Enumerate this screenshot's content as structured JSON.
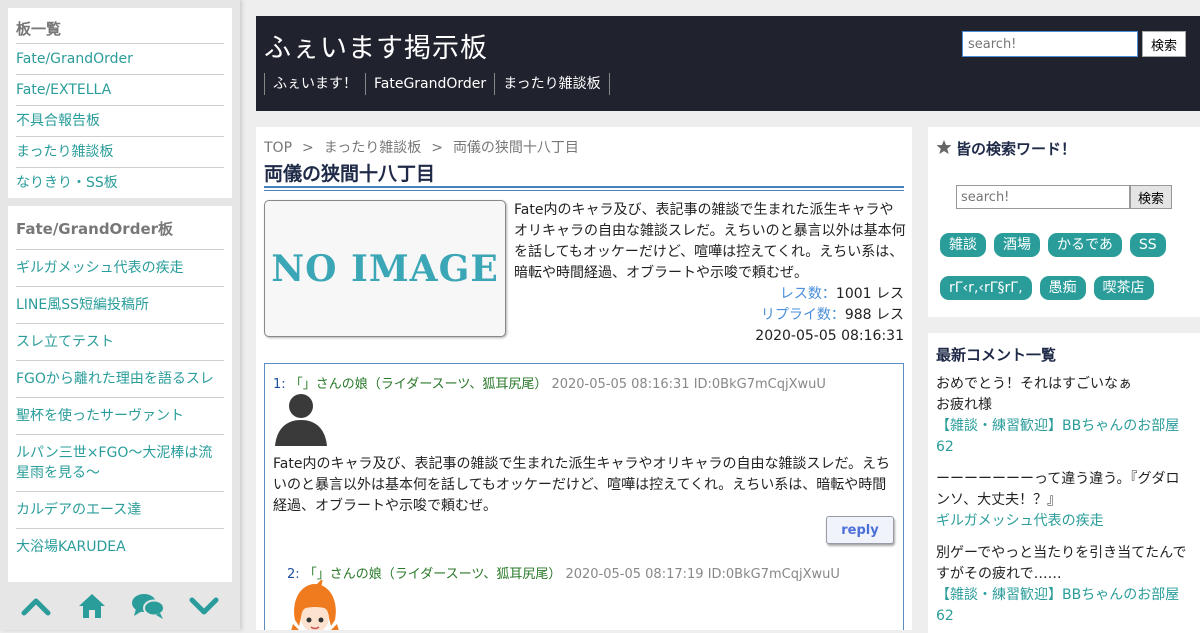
{
  "boards": {
    "title": "板一覧",
    "items": [
      "Fate/GrandOrder",
      "Fate/EXTELLA",
      "不具合報告板",
      "まったり雑談板",
      "なりきり・SS板"
    ]
  },
  "threads": {
    "title": "Fate/GrandOrder板",
    "items": [
      "ギルガメッシュ代表の疾走",
      "LINE風SS短編投稿所",
      "スレ立てテスト",
      "FGOから離れた理由を語るスレ",
      "聖杯を使ったサーヴァント",
      "ルパン三世×FGO～大泥棒は流星雨を見る～",
      "カルデアのエース達",
      "大浴場KARUDEA"
    ]
  },
  "header": {
    "site_title": "ふぇいます掲示板",
    "nav": [
      "ふぇいます！",
      "FateGrandOrder",
      "まったり雑談板"
    ],
    "search_placeholder": "search!",
    "search_button": "検索"
  },
  "breadcrumb": {
    "top": "TOP",
    "sep": ">",
    "board": "まったり雑談板",
    "thread": "両儀の狭間十八丁目"
  },
  "thread": {
    "title": "両儀の狭間十八丁目",
    "image_text": "NO IMAGE",
    "description": "Fate内のキャラ及び、表記事の雑談で生まれた派生キャラやオリキャラの自由な雑談スレだ。えちいのと暴言以外は基本何を話してもオッケーだけど、喧嘩は控えてくれ。えちい系は、暗転や時間経過、オブラートや示唆で頼むぜ。",
    "res_label": "レス数：",
    "res_value": "1001 レス",
    "reply_label": "リプライ数：",
    "reply_value": "988 レス",
    "date": "2020-05-05 08:16:31"
  },
  "posts": [
    {
      "num": "1:",
      "name": "「」さんの娘（ライダースーツ、狐耳尻尾）",
      "date": "2020-05-05 08:16:31",
      "id": "ID:0BkG7mCqjXwuU",
      "body": "Fate内のキャラ及び、表記事の雑談で生まれた派生キャラやオリキャラの自由な雑談スレだ。えちいのと暴言以外は基本何を話してもオッケーだけど、喧嘩は控えてくれ。えちい系は、暗転や時間経過、オブラートや示唆で頼むぜ。",
      "reply_label": "reply"
    },
    {
      "num": "2:",
      "name": "「」さんの娘（ライダースーツ、狐耳尻尾）",
      "date": "2020-05-05 08:17:19",
      "id": "ID:0BkG7mCqjXwuU"
    }
  ],
  "search_words": {
    "title": "皆の検索ワード！",
    "placeholder": "search!",
    "button": "検索",
    "tags": [
      "雑談",
      "酒場",
      "かるであ",
      "SS",
      "rΓ‹r‚‹rΓ§rΓ‚",
      "愚痴",
      "喫茶店"
    ]
  },
  "latest_comments": {
    "title": "最新コメント一覧",
    "items": [
      {
        "text": "おめでとう！それはすごいなぁ\nお疲れ様",
        "link": "【雑談・練習歓迎】BBちゃんのお部屋62"
      },
      {
        "text": "ーーーーーーーって違う違う。『グダロンソ、大丈夫！？』",
        "link": "ギルガメッシュ代表の疾走"
      },
      {
        "text": "別ゲーでやっと当たりを引き当てたんですがその疲れで……",
        "link": "【雑談・練習歓迎】BBちゃんのお部屋62"
      }
    ]
  },
  "colors": {
    "accent": "#2a9d9b",
    "header_bg": "#20222e",
    "link_blue": "#4a8fd8"
  }
}
